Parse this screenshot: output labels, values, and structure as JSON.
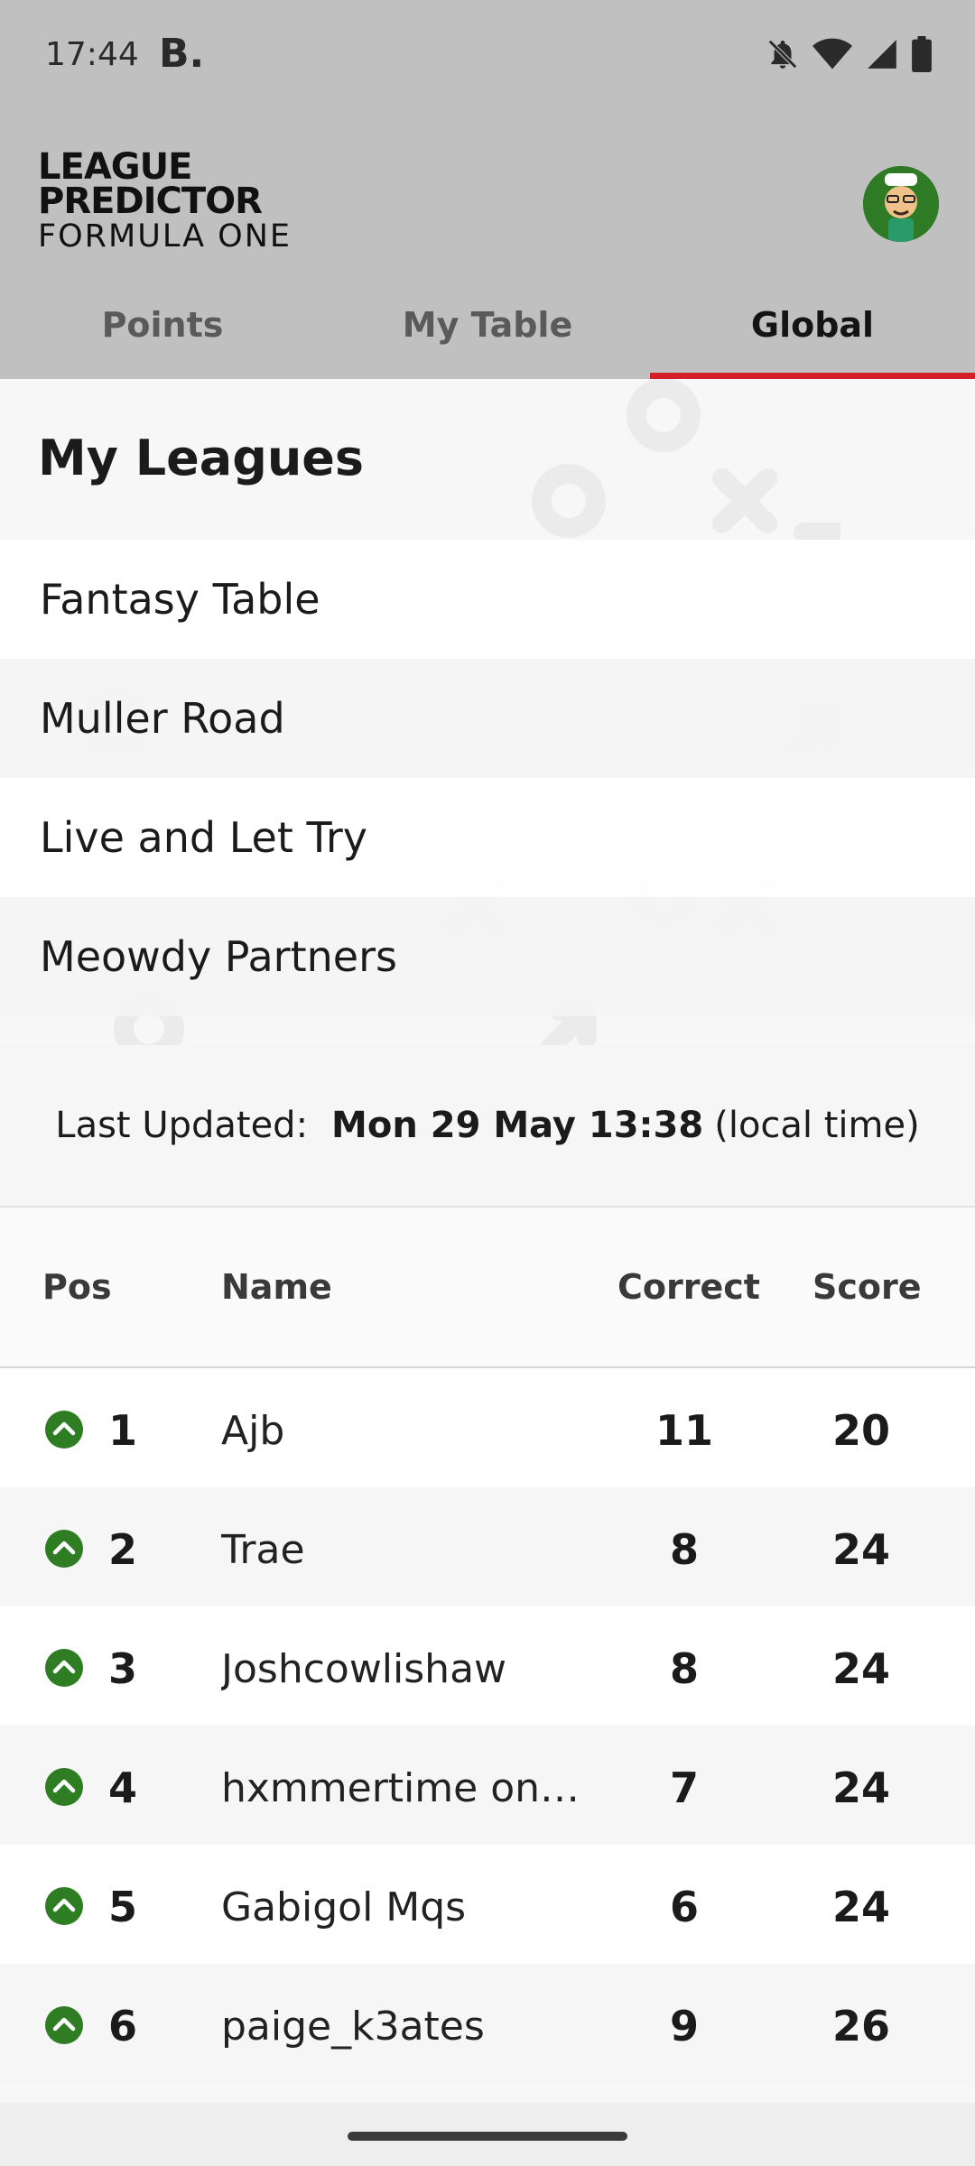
{
  "status_bar": {
    "time": "17:44",
    "app_badge": "B.",
    "icons": [
      "bell-off-icon",
      "wifi-icon",
      "signal-icon",
      "battery-icon"
    ]
  },
  "header": {
    "logo": {
      "line1": "LEAGUE",
      "line2": "PREDICTOR",
      "line3": "FORMULA ONE"
    },
    "avatar_icon": "avatar"
  },
  "tabs": [
    {
      "label": "Points",
      "active": false
    },
    {
      "label": "My Table",
      "active": false
    },
    {
      "label": "Global",
      "active": true
    }
  ],
  "my_leagues": {
    "title": "My Leagues",
    "items": [
      "Fantasy Table",
      "Muller Road",
      "Live and Let Try",
      "Meowdy Partners"
    ]
  },
  "last_updated": {
    "label": "Last Updated:",
    "value": "Mon 29 May 13:38",
    "suffix": "(local time)"
  },
  "table": {
    "headers": {
      "pos": "Pos",
      "name": "Name",
      "correct": "Correct",
      "score": "Score"
    },
    "rows": [
      {
        "pos": "1",
        "name": "Ajb",
        "correct": "11",
        "score": "20",
        "trend": "up"
      },
      {
        "pos": "2",
        "name": "Trae",
        "correct": "8",
        "score": "24",
        "trend": "up"
      },
      {
        "pos": "3",
        "name": "Joshcowlishaw",
        "correct": "8",
        "score": "24",
        "trend": "up"
      },
      {
        "pos": "4",
        "name": "hxmmertime on t...",
        "correct": "7",
        "score": "24",
        "trend": "up"
      },
      {
        "pos": "5",
        "name": "Gabigol Mqs",
        "correct": "6",
        "score": "24",
        "trend": "up"
      },
      {
        "pos": "6",
        "name": "paige_k3ates",
        "correct": "9",
        "score": "26",
        "trend": "up"
      }
    ]
  },
  "colors": {
    "header_bg": "#c0c0c0",
    "accent_red": "#d32028",
    "trend_up_green": "#2e7d23"
  }
}
